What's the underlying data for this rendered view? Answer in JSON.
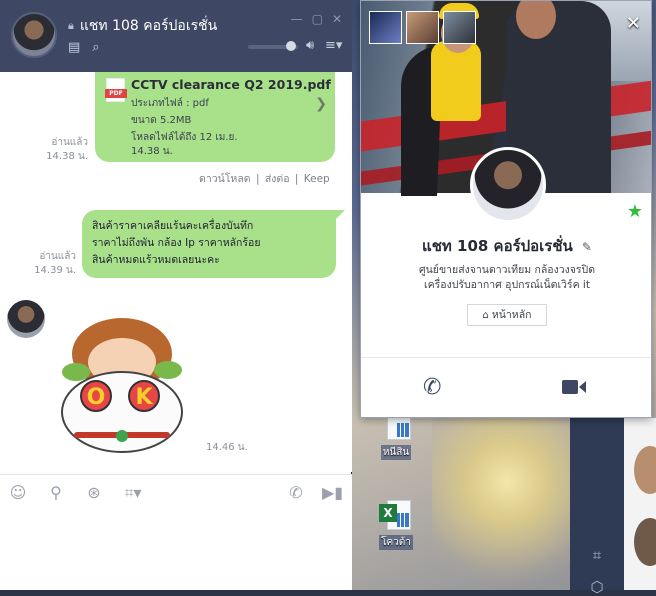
{
  "chat": {
    "title": "แชท 108 คอร์ปอเรชั่น",
    "window_controls": [
      "—",
      "▢",
      "✕"
    ]
  },
  "file_message": {
    "file_name": "CCTV clearance Q2 2019.pdf",
    "file_type_line": "ประเภทไฟล์ : pdf",
    "size_line": "ขนาด 5.2MB",
    "expiry_line": "โหลดไฟล์ได้ถึง 12 เม.ย.",
    "expiry_time_line": "14.38 น.",
    "pdf_tag": "PDF",
    "read_label": "อ่านแล้ว",
    "time": "14.38 น.",
    "actions": {
      "download": "ดาวน์โหลด",
      "forward": "ส่งต่อ",
      "keep": "Keep",
      "separator": "|"
    }
  },
  "text_message": {
    "text": "สินค้าราคาเคลียแร้นคะเครื่องบันทึก\nราคาไม่ถึงพัน  กล้อง Ip  ราคาหลักร้อย\nสินค้าหมดแร้วหมดเลยนะคะ",
    "read_label": "อ่านแล้ว",
    "time": "14.39 น."
  },
  "sticker_message": {
    "sticker_text": "OK",
    "time": "14.46 น."
  },
  "profile": {
    "name": "แชท 108 คอร์ปอเรชั่น",
    "status": "ศูนย์ขายส่งจานดาวเทียม กล้องวงจรปิด\nเครื่องปรับอากาศ  อุปกรณ์เน็ตเวิร์ค  it",
    "home_button": "หน้าหลัก",
    "close": "✕"
  },
  "desktop": {
    "icons": [
      {
        "label": "หนีสิน"
      },
      {
        "label": "โควต้า"
      }
    ]
  },
  "colors": {
    "header": "#3e4864",
    "bubble": "#a9e18b",
    "favorite": "#2fbf3a"
  }
}
